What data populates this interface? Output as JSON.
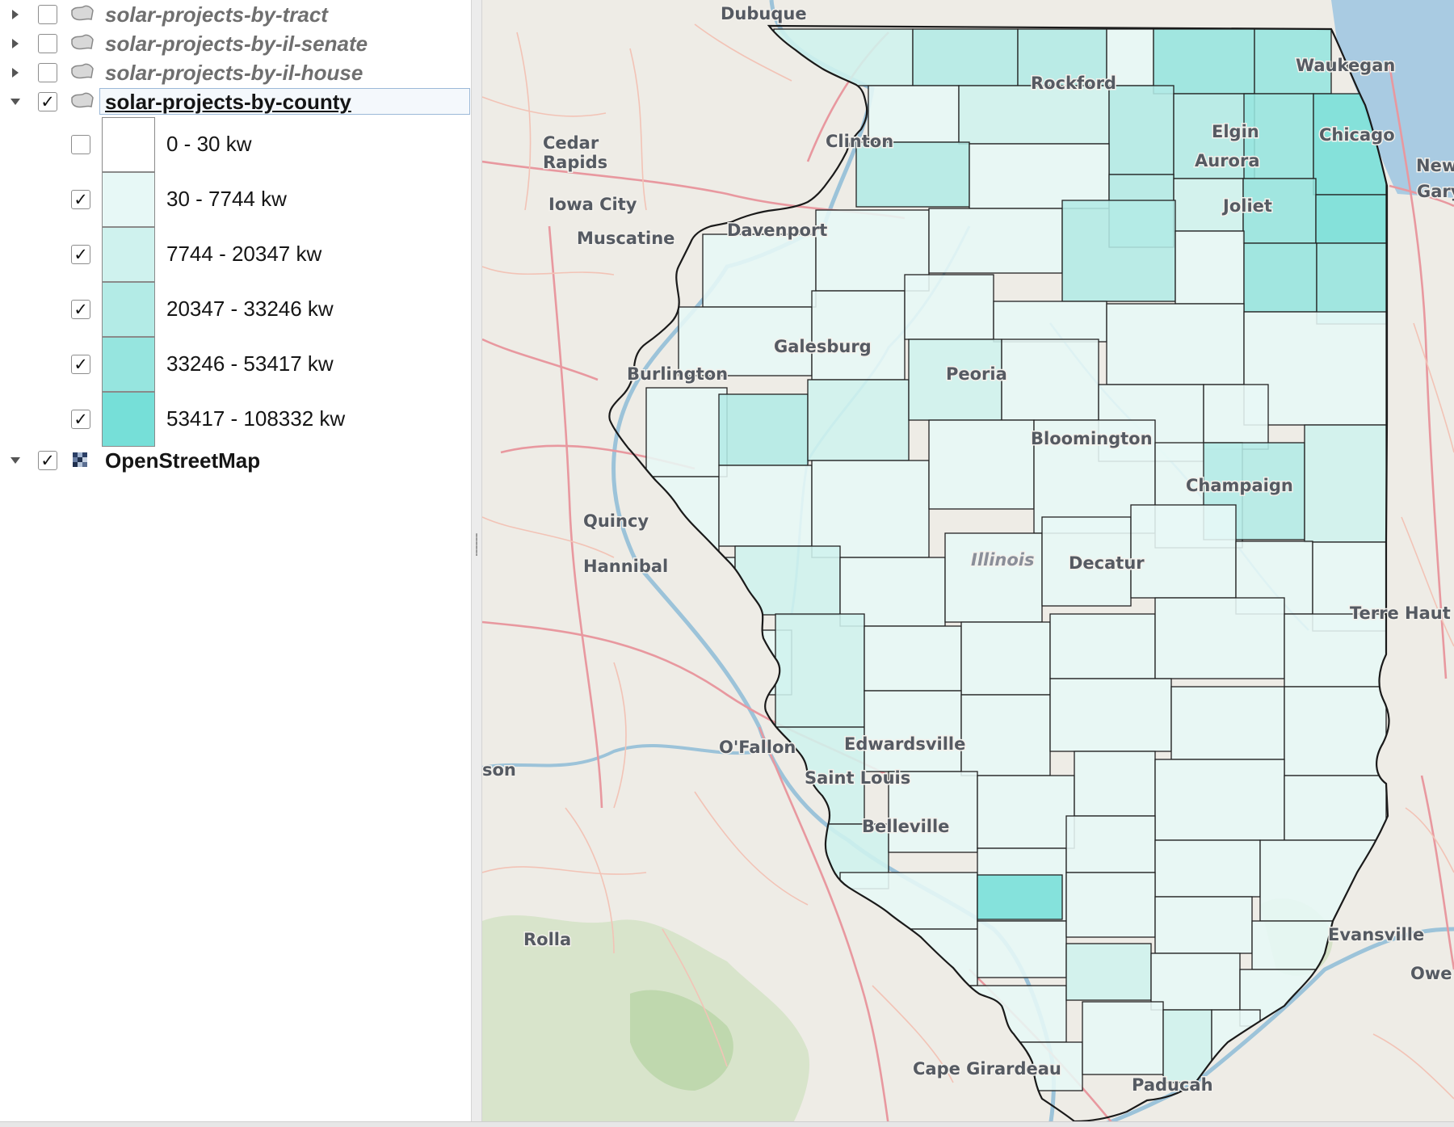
{
  "layers": [
    {
      "name": "solar-projects-by-tract",
      "checked": false,
      "expanded": false,
      "active": false
    },
    {
      "name": "solar-projects-by-il-senate",
      "checked": false,
      "expanded": false,
      "active": false
    },
    {
      "name": "solar-projects-by-il-house",
      "checked": false,
      "expanded": false,
      "active": false
    },
    {
      "name": "solar-projects-by-county",
      "checked": true,
      "expanded": true,
      "active": true
    },
    {
      "name": "OpenStreetMap",
      "checked": true,
      "expanded": true,
      "active": false
    }
  ],
  "legend": [
    {
      "label": "0 - 30 kw",
      "checked": false,
      "color": "#ffffff"
    },
    {
      "label": "30 - 7744 kw",
      "checked": true,
      "color": "#e7f8f6"
    },
    {
      "label": "7744 - 20347 kw",
      "checked": true,
      "color": "#cff2ee"
    },
    {
      "label": "20347 - 33246 kw",
      "checked": true,
      "color": "#b3ebe6"
    },
    {
      "label": "33246 - 53417 kw",
      "checked": true,
      "color": "#96e5df"
    },
    {
      "label": "53417 - 108332 kw",
      "checked": true,
      "color": "#76dfd8"
    }
  ],
  "map": {
    "city_labels": [
      "Dubuque",
      "Waukegan",
      "Rockford",
      "Cedar Rapids",
      "Clinton",
      "Elgin",
      "Chicago",
      "Aurora",
      "New",
      "Gary",
      "Iowa City",
      "Joliet",
      "Muscatine",
      "Davenport",
      "Galesburg",
      "Burlington",
      "Peoria",
      "Bloomington",
      "Champaign",
      "Quincy",
      "Illinois",
      "Decatur",
      "Hannibal",
      "Terre Haut",
      "O'Fallon",
      "Edwardsville",
      "son",
      "Saint Louis",
      "Belleville",
      "Evansville",
      "Rolla",
      "Owe",
      "Cape Girardeau",
      "Paducah"
    ],
    "colors": {
      "background": "#eeece6",
      "highway": "#e8989f",
      "road": "#f3c3b6",
      "river": "#9cc3d9",
      "lake": "#a9cbe2",
      "forest": "#cfe0c1",
      "outline": "#222222"
    }
  }
}
